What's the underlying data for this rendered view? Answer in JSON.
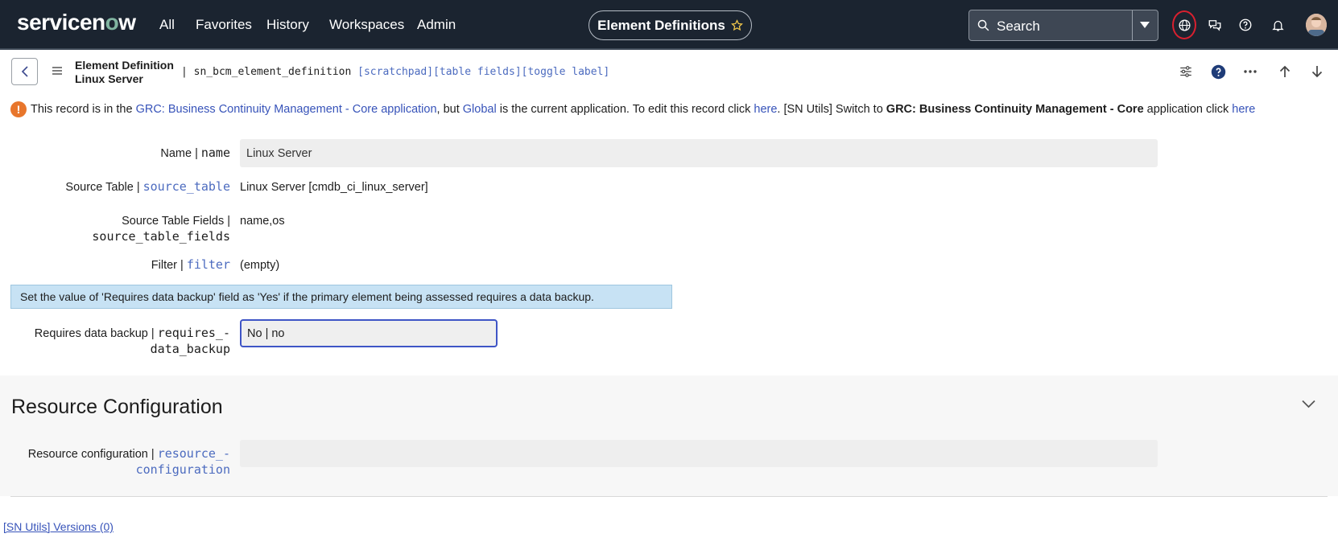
{
  "topnav": {
    "logo": {
      "pre": "servicen",
      "o": "o",
      "post": "w"
    },
    "items": [
      "All",
      "Favorites",
      "History",
      "Workspaces",
      "Admin"
    ],
    "context_title": "Element Definitions",
    "search_placeholder": "Search"
  },
  "form_header": {
    "title_line1": "Element Definition",
    "title_line2": "Linux Server",
    "table_name": "| sn_bcm_element_definition",
    "links": [
      "[scratchpad]",
      "[table fields]",
      "[toggle label]"
    ]
  },
  "info_message": {
    "p1": "This record is in the ",
    "app": "GRC: Business Continuity Management - Core",
    "p2": " application",
    "p3": ", but ",
    "global": "Global",
    "p4": " is the current application. To edit this record click ",
    "here1": "here",
    "p5": ".  [SN Utils] Switch to ",
    "switch_app": "GRC: Business Continuity Management - Core",
    "p6": " application click ",
    "here2": "here"
  },
  "fields": {
    "name": {
      "label": "Name | ",
      "code": "name",
      "value": "Linux Server"
    },
    "source_table": {
      "label": "Source Table | ",
      "code": "source_table",
      "value": "Linux Server [cmdb_ci_linux_server]"
    },
    "source_table_fields": {
      "label": "Source Table Fields |",
      "code": "source_table_fields",
      "value": "name,os"
    },
    "filter": {
      "label": "Filter | ",
      "code": "filter",
      "value": "(empty)"
    },
    "hint": "Set the value of 'Requires data backup' field as 'Yes' if the primary element being assessed requires a data backup.",
    "requires_data_backup": {
      "label": "Requires data backup | ",
      "code1": "requires_-",
      "code2": "data_backup",
      "value": "No | no"
    }
  },
  "resource_section": {
    "title": "Resource Configuration",
    "field": {
      "label": "Resource configuration | ",
      "code1": "resource_-",
      "code2": "configuration",
      "value": ""
    }
  },
  "footer": {
    "versions_link": "[SN Utils] Versions (0)"
  },
  "colors": {
    "nav_bg": "#1b2430",
    "accent_link": "#3753b9",
    "hint_bg": "#c7e2f4",
    "focus_border": "#3f55c6",
    "warning": "#e8762c",
    "globe_ring": "#d9202f"
  }
}
